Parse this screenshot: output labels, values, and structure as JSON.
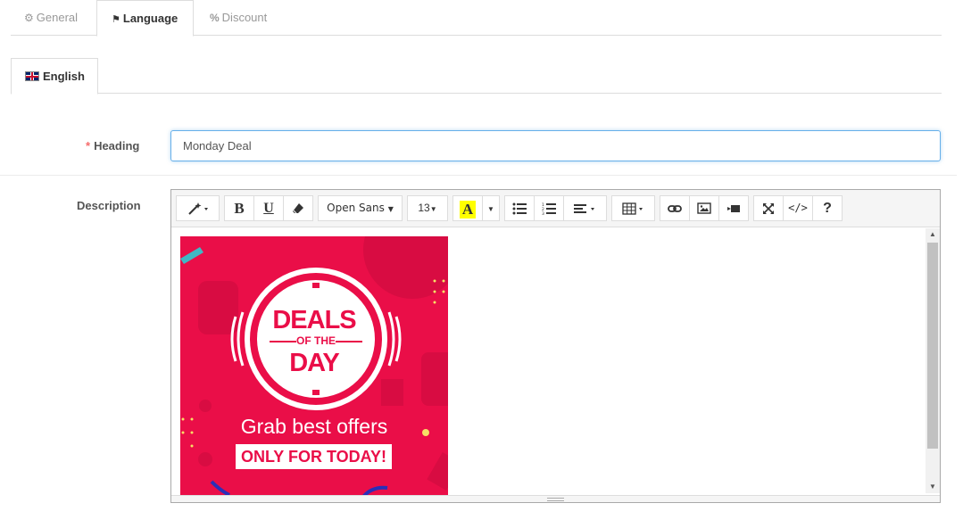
{
  "tabs": [
    {
      "label": "General",
      "icon": "gear-icon"
    },
    {
      "label": "Language",
      "icon": "flag-icon"
    },
    {
      "label": "Discount",
      "icon": "percent-icon"
    }
  ],
  "language_tab": {
    "label": "English",
    "icon": "uk-flag-icon"
  },
  "heading": {
    "required_mark": "*",
    "label": "Heading",
    "value": "Monday Deal"
  },
  "description": {
    "label": "Description"
  },
  "editor": {
    "font_family": "Open Sans",
    "font_size": "13",
    "highlight_letter": "A",
    "help": "?",
    "code": "</>",
    "bold": "B",
    "underline": "U"
  },
  "banner": {
    "line1": "DEALS",
    "line2": "OF THE",
    "line3": "DAY",
    "tagline": "Grab best offers",
    "cta": "ONLY FOR TODAY!"
  },
  "colors": {
    "banner_bg": "#ea0e48",
    "accent": "#66afe9",
    "required": "#f56b6b"
  }
}
